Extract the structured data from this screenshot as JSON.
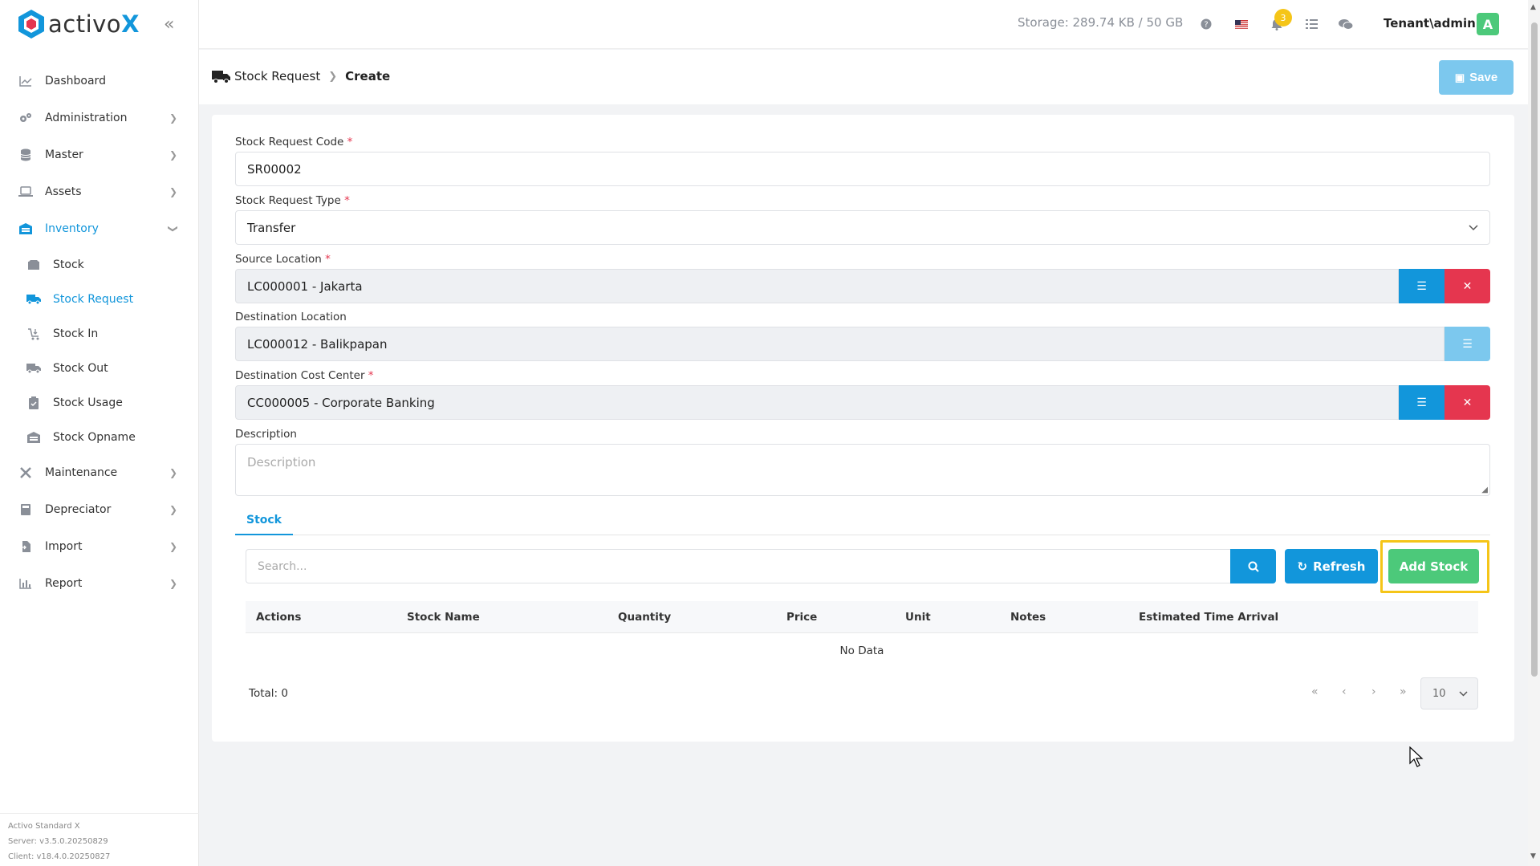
{
  "brand": {
    "name": "activo",
    "name_x": "X"
  },
  "sidebar": {
    "items": [
      {
        "label": "Dashboard",
        "icon": "chart-line-icon"
      },
      {
        "label": "Administration",
        "icon": "gears-icon"
      },
      {
        "label": "Master",
        "icon": "database-icon"
      },
      {
        "label": "Assets",
        "icon": "laptop-icon"
      },
      {
        "label": "Inventory",
        "icon": "warehouse-icon",
        "active": true
      },
      {
        "label": "Maintenance",
        "icon": "tools-icon"
      },
      {
        "label": "Depreciator",
        "icon": "calculator-icon"
      },
      {
        "label": "Import",
        "icon": "file-import-icon"
      },
      {
        "label": "Report",
        "icon": "bar-chart-icon"
      }
    ],
    "sub_items": [
      {
        "label": "Stock",
        "icon": "box-icon"
      },
      {
        "label": "Stock Request",
        "icon": "truck-icon",
        "active": true
      },
      {
        "label": "Stock In",
        "icon": "cart-in-icon"
      },
      {
        "label": "Stock Out",
        "icon": "truck-out-icon"
      },
      {
        "label": "Stock Usage",
        "icon": "clipboard-check-icon"
      },
      {
        "label": "Stock Opname",
        "icon": "warehouse-icon"
      }
    ],
    "footer": {
      "product": "Activo Standard X",
      "server": "Server: v3.5.0.20250829",
      "client": "Client: v18.4.0.20250827"
    }
  },
  "topbar": {
    "storage": "Storage: 289.74 KB / 50 GB",
    "notification_count": "3",
    "user": "Tenant\\admin",
    "avatar_letter": "A"
  },
  "header": {
    "breadcrumb_parent": "Stock Request",
    "breadcrumb_current": "Create",
    "save_label": "Save"
  },
  "form": {
    "code_label": "Stock Request Code",
    "code_value": "SR00002",
    "type_label": "Stock Request Type",
    "type_value": "Transfer",
    "source_label": "Source Location",
    "source_value": "LC000001 - Jakarta",
    "dest_label": "Destination Location",
    "dest_value": "LC000012 - Balikpapan",
    "cost_center_label": "Destination Cost Center",
    "cost_center_value": "CC000005 - Corporate Banking",
    "description_label": "Description",
    "description_placeholder": "Description",
    "required_mark": "*"
  },
  "stock_tab": {
    "tab_label": "Stock",
    "search_placeholder": "Search...",
    "refresh_label": "Refresh",
    "add_label": "Add Stock",
    "columns": [
      "Actions",
      "Stock Name",
      "Quantity",
      "Price",
      "Unit",
      "Notes",
      "Estimated Time Arrival"
    ],
    "empty_text": "No Data",
    "total": "Total: 0",
    "page_size": "10"
  },
  "colors": {
    "accent": "#1296db",
    "success": "#4cc97a",
    "danger": "#e5364f",
    "highlight": "#f5c518"
  }
}
